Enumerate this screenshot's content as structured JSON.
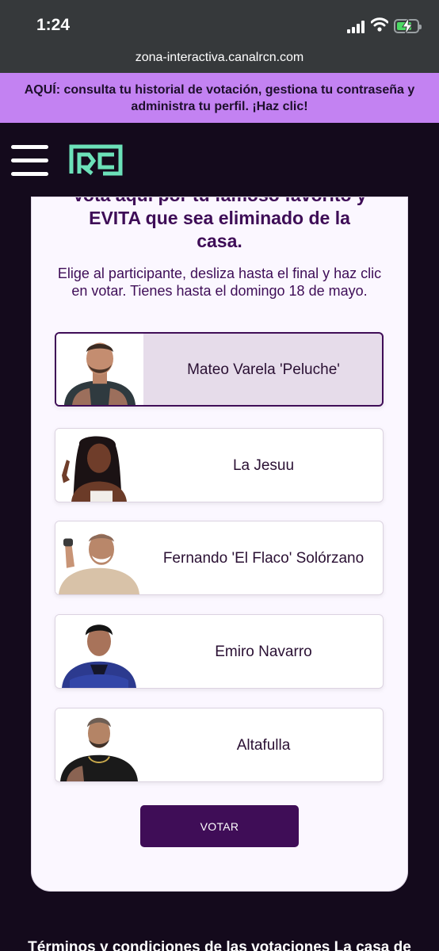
{
  "status_bar": {
    "time": "1:24",
    "icons": [
      "signal-icon",
      "wifi-icon",
      "battery-charging-icon"
    ]
  },
  "browser": {
    "url": "zona-interactiva.canalrcn.com"
  },
  "banner": {
    "text": "AQUÍ: consulta tu historial de votación, gestiona tu contraseña y administra tu perfil. ¡Haz clic!",
    "background": "#c382f2"
  },
  "nav": {
    "menu_icon": "hamburger-menu-icon",
    "logo": "rcn-logo",
    "logo_color": "#6ce1b9"
  },
  "vote": {
    "heading": "Vota aquí por tu famoso favorito y EVITA que sea eliminado de la casa.",
    "instructions": "Elige al participante, desliza hasta el final y haz clic en votar. Tienes hasta el domingo 18 de mayo.",
    "participants": [
      {
        "name": "Mateo Varela 'Peluche'",
        "selected": true
      },
      {
        "name": "La Jesuu",
        "selected": false
      },
      {
        "name": "Fernando 'El Flaco' Solórzano",
        "selected": false
      },
      {
        "name": "Emiro Navarro",
        "selected": false
      },
      {
        "name": "Altafulla",
        "selected": false
      }
    ],
    "button_label": "VOTAR",
    "accent": "#3f0d57"
  },
  "footer": {
    "text": "Términos y condiciones de las votaciones La casa de"
  }
}
